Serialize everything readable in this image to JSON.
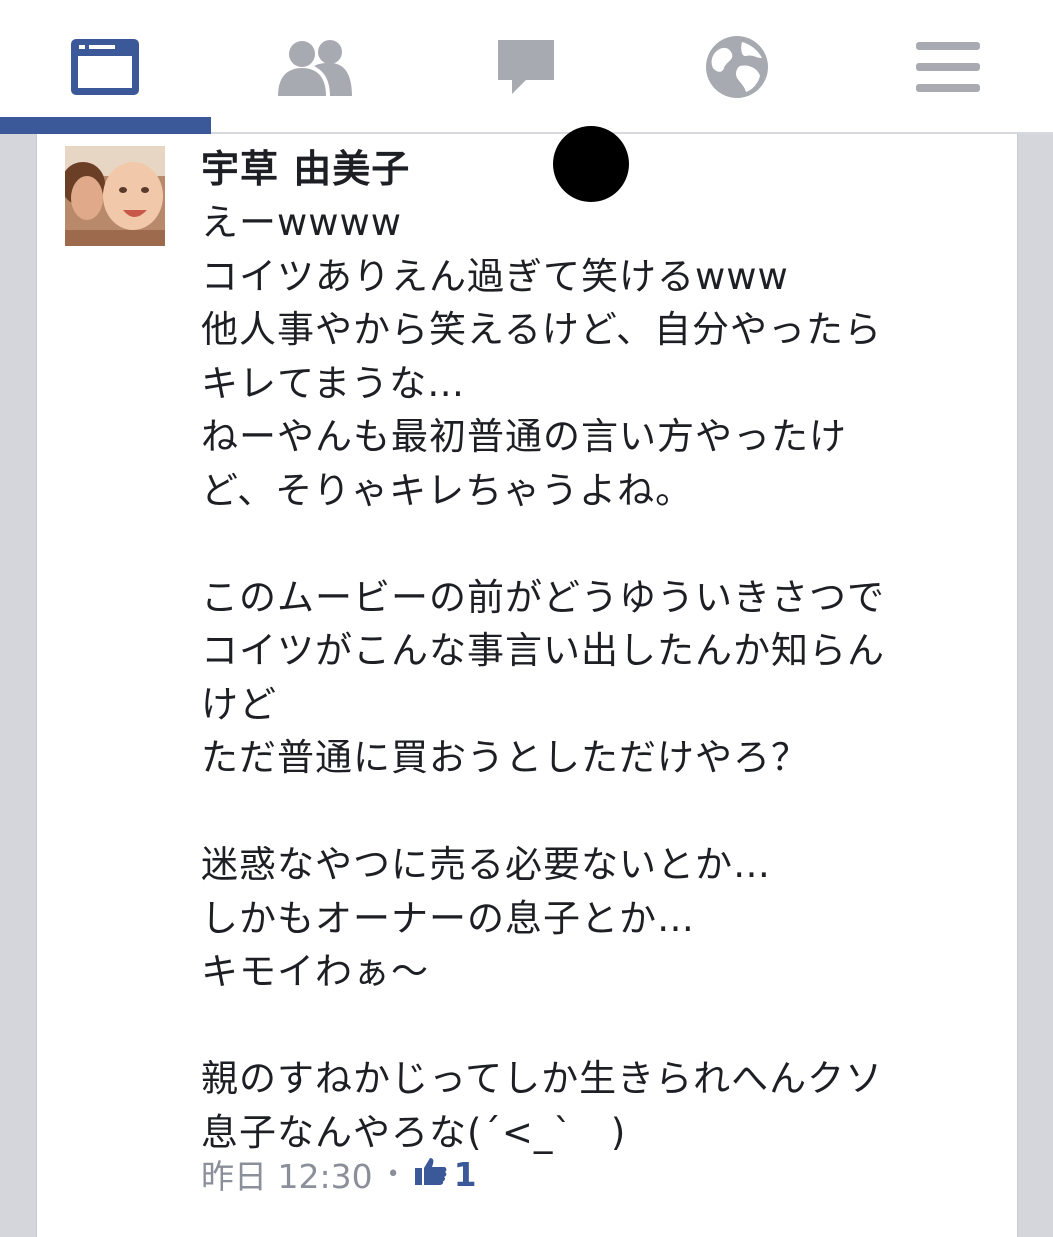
{
  "nav": {
    "tabs": [
      {
        "name": "news-feed",
        "icon": "news-feed-icon",
        "active": true
      },
      {
        "name": "friends",
        "icon": "friends-icon",
        "active": false
      },
      {
        "name": "messages",
        "icon": "messages-icon",
        "active": false
      },
      {
        "name": "notifications",
        "icon": "globe-icon",
        "active": false
      },
      {
        "name": "more",
        "icon": "hamburger-menu-icon",
        "active": false
      }
    ],
    "active_color": "#3b5998",
    "inactive_color": "#a7aab0"
  },
  "post": {
    "author": "宇草 由美子",
    "text": "えーwwww\nコイツありえん過ぎて笑けるwww\n他人事やから笑えるけど、自分やったら\nキレてまうな…\nねーやんも最初普通の言い方やったけ\nど、そりゃキレちゃうよね。\n\nこのムービーの前がどうゆういきさつで\nコイツがこんな事言い出したんか知らん\nけど\nただ普通に買おうとしただけやろ？\n\n迷惑なやつに売る必要ないとか…\nしかもオーナーの息子とか…\nキモイわぁ〜\n\n親のすねかじってしか生きられへんクソ\n息子なんやろな(´<_`　)",
    "timestamp": "昨日 12:30",
    "separator": "•",
    "like_count": "1"
  }
}
